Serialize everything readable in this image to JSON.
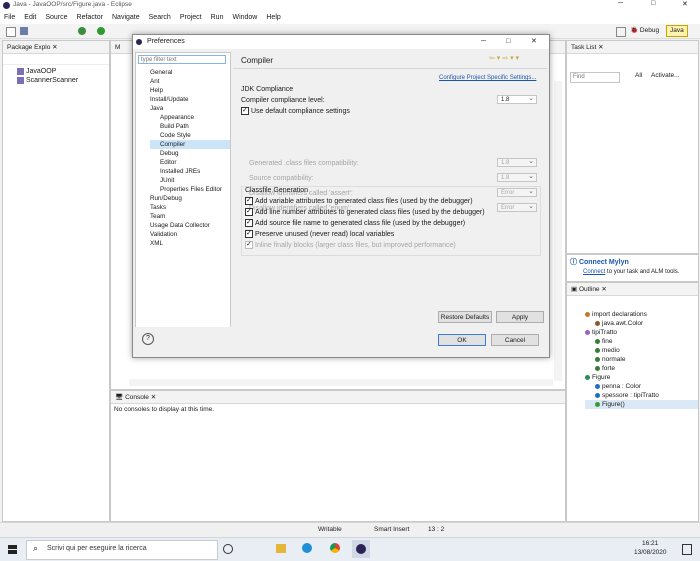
{
  "window": {
    "title": "Java - JavaOOP/src/Figure.java - Eclipse",
    "min": "─",
    "max": "□",
    "close": "✕"
  },
  "menu": [
    "File",
    "Edit",
    "Source",
    "Refactor",
    "Navigate",
    "Search",
    "Project",
    "Run",
    "Window",
    "Help"
  ],
  "perspectives": {
    "debug": "Debug",
    "java": "Java"
  },
  "package_explorer": {
    "title": "Package Explo",
    "items": [
      "JavaOOP",
      "ScannerScanner"
    ]
  },
  "editor_tab": "M",
  "task_list": {
    "title": "Task List",
    "find_placeholder": "Find",
    "all": "All",
    "activate": "Activate..."
  },
  "mylyn": {
    "title": "Connect Mylyn",
    "text_link": "Connect",
    "text_rest": "to your task and ALM tools."
  },
  "outline": {
    "title": "Outline",
    "items": [
      "import declarations",
      "java.awt.Color",
      "tipiTratto",
      "fine",
      "medio",
      "normale",
      "forte",
      "Figure",
      "penna : Color",
      "spessore : tipiTratto",
      "Figure()"
    ]
  },
  "console": {
    "title": "Console",
    "message": "No consoles to display at this time."
  },
  "status": {
    "writable": "Writable",
    "insert": "Smart Insert",
    "position": "13 : 2"
  },
  "taskbar": {
    "search_placeholder": "Scrivi qui per eseguire la ricerca",
    "time": "16:21",
    "date": "13/08/2020"
  },
  "dialog": {
    "title": "Preferences",
    "filter_placeholder": "type filter text",
    "page_title": "Compiler",
    "configure_link": "Configure Project Specific Settings...",
    "nav": [
      {
        "label": "General",
        "indent": 0
      },
      {
        "label": "Ant",
        "indent": 0
      },
      {
        "label": "Help",
        "indent": 0
      },
      {
        "label": "Install/Update",
        "indent": 0
      },
      {
        "label": "Java",
        "indent": 0
      },
      {
        "label": "Appearance",
        "indent": 1
      },
      {
        "label": "Build Path",
        "indent": 1
      },
      {
        "label": "Code Style",
        "indent": 1
      },
      {
        "label": "Compiler",
        "indent": 1
      },
      {
        "label": "Debug",
        "indent": 1
      },
      {
        "label": "Editor",
        "indent": 1
      },
      {
        "label": "Installed JREs",
        "indent": 1
      },
      {
        "label": "JUnit",
        "indent": 1
      },
      {
        "label": "Properties Files Editor",
        "indent": 1
      },
      {
        "label": "Run/Debug",
        "indent": 0
      },
      {
        "label": "Tasks",
        "indent": 0
      },
      {
        "label": "Team",
        "indent": 0
      },
      {
        "label": "Usage Data Collector",
        "indent": 0
      },
      {
        "label": "Validation",
        "indent": 0
      },
      {
        "label": "XML",
        "indent": 0
      }
    ],
    "jdk_group": "JDK Compliance",
    "compliance_label": "Compiler compliance level:",
    "compliance_value": "1.8",
    "use_default_label": "Use default compliance settings",
    "disabled_rows": [
      {
        "label": "Generated .class files compatibility:",
        "value": "1.8"
      },
      {
        "label": "Source compatibility:",
        "value": "1.8"
      },
      {
        "label": "Disallow identifiers called 'assert':",
        "value": "Error"
      },
      {
        "label": "Disallow identifiers called 'enum':",
        "value": "Error"
      }
    ],
    "classfile_group": "Classfile Generation",
    "classfile_options": [
      {
        "label": "Add variable attributes to generated class files (used by the debugger)",
        "checked": true,
        "enabled": true
      },
      {
        "label": "Add line number attributes to generated class files (used by the debugger)",
        "checked": true,
        "enabled": true
      },
      {
        "label": "Add source file name to generated class file (used by the debugger)",
        "checked": true,
        "enabled": true
      },
      {
        "label": "Preserve unused (never read) local variables",
        "checked": true,
        "enabled": true
      },
      {
        "label": "Inline finally blocks (larger class files, but improved performance)",
        "checked": true,
        "enabled": false
      }
    ],
    "restore_defaults": "Restore Defaults",
    "apply": "Apply",
    "ok": "OK",
    "cancel": "Cancel",
    "help_icon": "?"
  }
}
